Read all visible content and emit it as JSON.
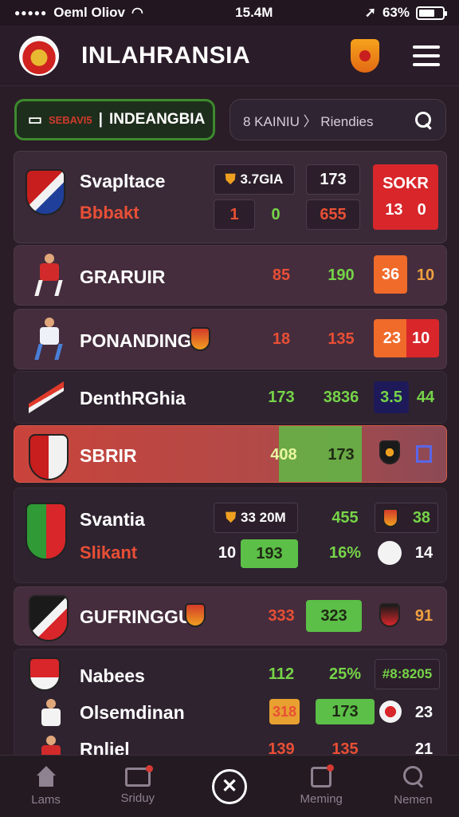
{
  "status_bar": {
    "carrier": "Oeml Oliov",
    "time": "15.4M",
    "battery": "63%"
  },
  "header": {
    "title": "INLAHRANSIA"
  },
  "filters": {
    "league_tag": "SEBAVI5",
    "league_label": "INDEANGBIA",
    "search_crumb": "8 KAINIU 〉 Riendies"
  },
  "rows": {
    "r1": {
      "name": "Svapltace",
      "sub": "Bbbakt",
      "badge_text": "3.7GIA",
      "col2_top": "173",
      "sub_a": "1",
      "sub_b": "0",
      "sub_c": "655",
      "score_label": "SOKR",
      "score_a": "13",
      "score_b": "0"
    },
    "r2": {
      "name": "GRARUIR",
      "v1": "85",
      "v2": "190",
      "v3": "36",
      "v4": "10"
    },
    "r3": {
      "name": "PONANDINGN",
      "v1": "18",
      "v2": "135",
      "v3": "23",
      "v4": "10"
    },
    "r4": {
      "name": "DenthRGhia",
      "v1": "173",
      "v2": "3836",
      "v3": "3.5",
      "v4": "44"
    },
    "r5": {
      "name": "SBRIR",
      "v1": "408",
      "v2": "173"
    },
    "r6": {
      "name": "Svantia",
      "sub": "Slikant",
      "badge_text": "33 20M",
      "v1": "455",
      "v2": "38",
      "sub_a": "10",
      "sub_b": "193",
      "sub_c": "16%",
      "sub_d": "14"
    },
    "r7": {
      "name": "GUFRINGGUN",
      "v1": "333",
      "v2": "323",
      "v3": "91"
    },
    "r8": {
      "name": "Nabees",
      "sub": "Olsemdinan",
      "cut": "Rnliel",
      "v1": "112",
      "v2": "25%",
      "v3": "#8:8205",
      "sub_a": "318",
      "sub_b": "173",
      "sub_c": "23",
      "cut_a": "139",
      "cut_b": "135",
      "cut_c": "21"
    }
  },
  "nav": {
    "items": [
      "Lams",
      "Sriduy",
      "",
      "Meming",
      "Nemen"
    ]
  }
}
